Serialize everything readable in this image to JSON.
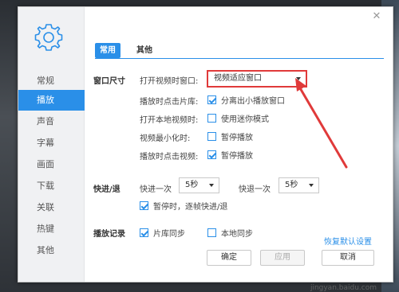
{
  "sidebar": {
    "logo_icon": "gear-icon",
    "items": [
      {
        "label": "常规",
        "active": false
      },
      {
        "label": "播放",
        "active": true
      },
      {
        "label": "声音",
        "active": false
      },
      {
        "label": "字幕",
        "active": false
      },
      {
        "label": "画面",
        "active": false
      },
      {
        "label": "下载",
        "active": false
      },
      {
        "label": "关联",
        "active": false
      },
      {
        "label": "热键",
        "active": false
      },
      {
        "label": "其他",
        "active": false
      }
    ]
  },
  "tabs": {
    "common": "常用",
    "other": "其他"
  },
  "window_size": {
    "section": "窗口尺寸",
    "open_video_label": "打开视频时窗口:",
    "open_video_value": "视频适应窗口",
    "library_label": "播放时点击片库:",
    "library_option": "分离出小播放窗口",
    "library_checked": true,
    "local_label": "打开本地视频时:",
    "local_option": "使用迷你模式",
    "local_checked": false,
    "minimize_label": "视频最小化时:",
    "minimize_option": "暂停播放",
    "minimize_checked": false,
    "click_label": "播放时点击视频:",
    "click_option": "暂停播放",
    "click_checked": true
  },
  "seek": {
    "section": "快进/退",
    "forward_label": "快进一次",
    "forward_value": "5秒",
    "backward_label": "快退一次",
    "backward_value": "5秒",
    "pause_option": "暂停时，逐帧快进/退",
    "pause_checked": true
  },
  "history": {
    "section": "播放记录",
    "library_sync": "片库同步",
    "library_sync_checked": true,
    "local_sync": "本地同步",
    "local_sync_checked": false
  },
  "restore_defaults": "恢复默认设置",
  "buttons": {
    "ok": "确定",
    "apply": "应用",
    "cancel": "取消"
  },
  "close_icon": "close-icon",
  "watermark": "jingyan.baidu.com",
  "colors": {
    "accent": "#2a8fe8",
    "annotation": "#e03a3a"
  }
}
